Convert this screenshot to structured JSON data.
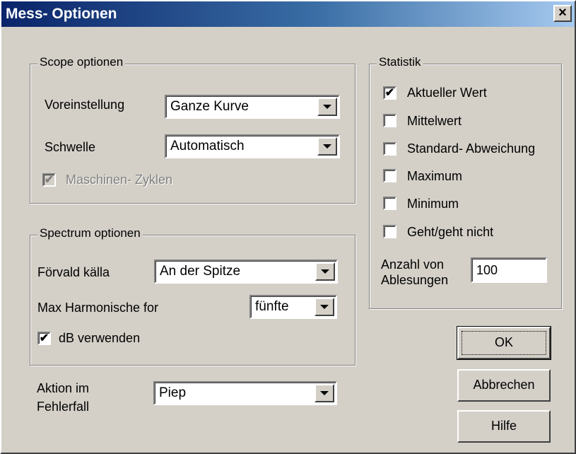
{
  "window": {
    "title": "Mess- Optionen",
    "close_label": "×"
  },
  "scope": {
    "legend": "Scope optionen",
    "voreinstellung_label": "Voreinstellung",
    "voreinstellung_value": "Ganze Kurve",
    "schwelle_label": "Schwelle",
    "schwelle_value": "Automatisch",
    "zyklen_label": "Maschinen- Zyklen",
    "zyklen_checked": true,
    "zyklen_enabled": false
  },
  "spectrum": {
    "legend": "Spectrum optionen",
    "quelle_label": "Förvald källa",
    "quelle_value": "An der Spitze",
    "harmonische_label": "Max Harmonische for",
    "harmonische_value": "fünfte",
    "db_label": "dB verwenden",
    "db_checked": true
  },
  "aktion": {
    "label_line1": "Aktion im",
    "label_line2": "Fehlerfall",
    "value": "Piep"
  },
  "statistik": {
    "legend": "Statistik",
    "items": [
      {
        "label": "Aktueller Wert",
        "checked": true
      },
      {
        "label": "Mittelwert",
        "checked": false
      },
      {
        "label": "Standard- Abweichung",
        "checked": false
      },
      {
        "label": "Maximum",
        "checked": false
      },
      {
        "label": "Minimum",
        "checked": false
      },
      {
        "label": "Geht/geht nicht",
        "checked": false
      }
    ],
    "anzahl_label_line1": "Anzahl von",
    "anzahl_label_line2": "Ablesungen",
    "anzahl_value": "100"
  },
  "buttons": {
    "ok": "OK",
    "cancel": "Abbrechen",
    "help": "Hilfe"
  },
  "check_mark": "✔"
}
